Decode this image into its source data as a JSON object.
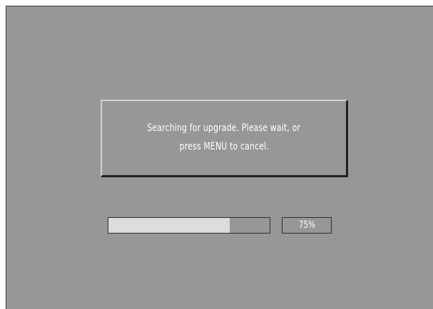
{
  "dialog": {
    "message_line_1": "Searching for upgrade. Please wait, or",
    "message_line_2": "press MENU to cancel."
  },
  "progress": {
    "value_fraction": 0.75,
    "label": "75%"
  },
  "colors": {
    "background": "#979797",
    "progress_fill": "#dcdcdc",
    "text": "#ffffff"
  }
}
